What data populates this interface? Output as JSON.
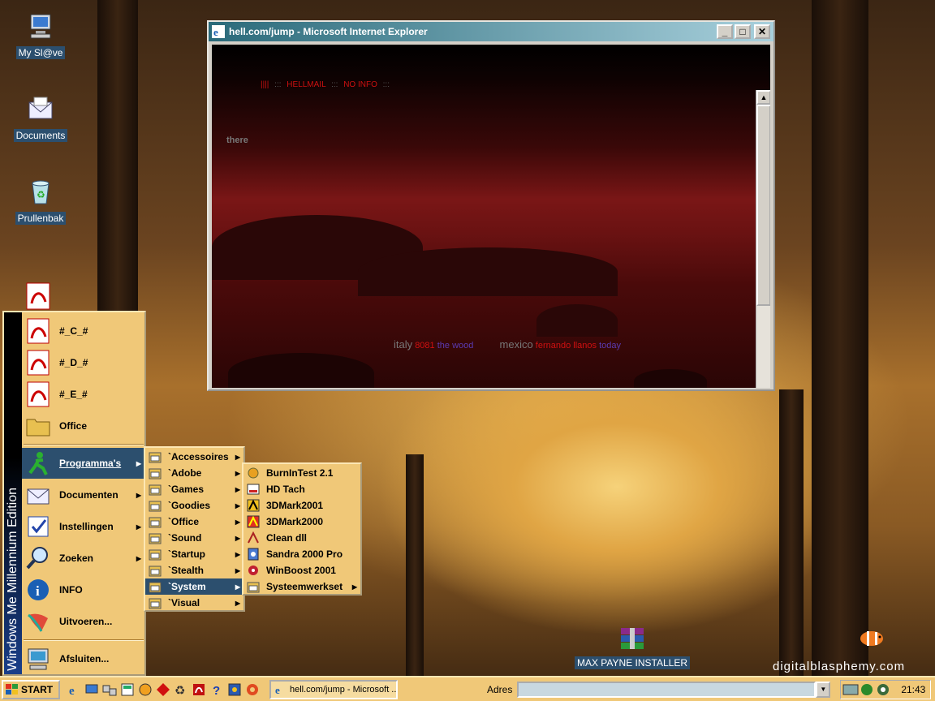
{
  "desktop": {
    "icons": [
      {
        "label": "My Sl@ve",
        "icon": "computer-icon"
      },
      {
        "label": "Documents",
        "icon": "documents-icon"
      },
      {
        "label": "Prullenbak",
        "icon": "recycle-bin-icon"
      }
    ],
    "max_payne_label": "MAX PAYNE INSTALLER",
    "watermark": "digitalblasphemy.com"
  },
  "ie_window": {
    "title": "hell.com/jump - Microsoft Internet Explorer",
    "nav": {
      "bars": "||||",
      "sep": ":::",
      "item1": "HELLMAIL",
      "item2": "NO INFO"
    },
    "there_text": "there",
    "links": {
      "italy": "italy",
      "italy_num": "8081",
      "italy_place": "the wood",
      "mexico": "mexico",
      "mexico_name": "fernando llanos",
      "mexico_when": "today"
    }
  },
  "start_menu": {
    "band_text": "Windows Me Millennium Edition",
    "top_items": [
      {
        "label": "#_C_#",
        "icon": "pdf-icon"
      },
      {
        "label": "#_D_#",
        "icon": "pdf-icon"
      },
      {
        "label": "#_E_#",
        "icon": "pdf-icon"
      },
      {
        "label": "Office",
        "icon": "folder-icon"
      }
    ],
    "main_items": [
      {
        "label": "Programma's",
        "icon": "programs-icon",
        "arrow": true
      },
      {
        "label": "Documenten",
        "icon": "documents-icon",
        "arrow": true
      },
      {
        "label": "Instellingen",
        "icon": "settings-icon",
        "arrow": true
      },
      {
        "label": "Zoeken",
        "icon": "search-icon",
        "arrow": true
      },
      {
        "label": "INFO",
        "icon": "info-icon",
        "arrow": false
      },
      {
        "label": "Uitvoeren...",
        "icon": "run-icon",
        "arrow": false
      },
      {
        "label": "Afsluiten...",
        "icon": "shutdown-icon",
        "arrow": false
      }
    ]
  },
  "programs_submenu": [
    "`Accessoires",
    "`Adobe",
    "`Games",
    "`Goodies",
    "`Office",
    "`Sound",
    "`Startup",
    "`Stealth",
    "`System",
    "`Visual"
  ],
  "system_submenu": [
    {
      "label": "BurnInTest 2.1",
      "arrow": false
    },
    {
      "label": "HD Tach",
      "arrow": false
    },
    {
      "label": "3DMark2001",
      "arrow": false
    },
    {
      "label": "3DMark2000",
      "arrow": false
    },
    {
      "label": "Clean dll",
      "arrow": false
    },
    {
      "label": "Sandra 2000 Pro",
      "arrow": false
    },
    {
      "label": "WinBoost 2001",
      "arrow": false
    },
    {
      "label": "Systeemwerkset",
      "arrow": true
    }
  ],
  "taskbar": {
    "start_label": "START",
    "task_label": "hell.com/jump - Microsoft ...",
    "address_label": "Adres",
    "address_value": "",
    "clock": "21:43"
  },
  "colors": {
    "accent": "#2c4f6e",
    "menu_bg": "#f0c878",
    "hell_red": "#cc1010"
  }
}
